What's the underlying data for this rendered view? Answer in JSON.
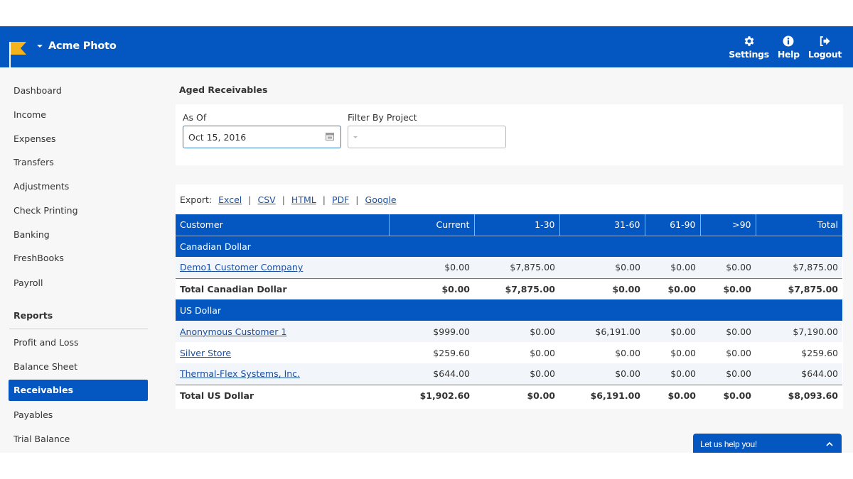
{
  "header": {
    "app_name": "Acme Photo",
    "actions": [
      {
        "label": "Settings",
        "icon": "gear-icon"
      },
      {
        "label": "Help",
        "icon": "info-icon"
      },
      {
        "label": "Logout",
        "icon": "logout-icon"
      }
    ]
  },
  "sidebar": {
    "items": [
      {
        "label": "Dashboard"
      },
      {
        "label": "Income"
      },
      {
        "label": "Expenses"
      },
      {
        "label": "Transfers"
      },
      {
        "label": "Adjustments"
      },
      {
        "label": "Check Printing"
      },
      {
        "label": "Banking"
      },
      {
        "label": "FreshBooks"
      },
      {
        "label": "Payroll"
      }
    ],
    "reports_heading": "Reports",
    "report_items": [
      {
        "label": "Profit and Loss"
      },
      {
        "label": "Balance Sheet"
      },
      {
        "label": "Receivables",
        "active": true
      },
      {
        "label": "Payables"
      },
      {
        "label": "Trial Balance"
      }
    ]
  },
  "main": {
    "title": "Aged Receivables",
    "filters": {
      "as_of_label": "As Of",
      "as_of_value": "Oct 15, 2016",
      "project_label": "Filter By Project",
      "project_value": ""
    },
    "export": {
      "label": "Export:",
      "links": [
        "Excel",
        "CSV",
        "HTML",
        "PDF",
        "Google"
      ]
    },
    "table": {
      "columns": [
        "Customer",
        "Current",
        "1-30",
        "31-60",
        "61-90",
        ">90",
        "Total"
      ],
      "groups": [
        {
          "name": "Canadian Dollar",
          "rows": [
            {
              "customer": "Demo1 Customer Company",
              "values": [
                "$0.00",
                "$7,875.00",
                "$0.00",
                "$0.00",
                "$0.00",
                "$7,875.00"
              ]
            }
          ],
          "total": {
            "label": "Total Canadian Dollar",
            "values": [
              "$0.00",
              "$7,875.00",
              "$0.00",
              "$0.00",
              "$0.00",
              "$7,875.00"
            ]
          }
        },
        {
          "name": "US Dollar",
          "rows": [
            {
              "customer": "Anonymous Customer 1",
              "values": [
                "$999.00",
                "$0.00",
                "$6,191.00",
                "$0.00",
                "$0.00",
                "$7,190.00"
              ]
            },
            {
              "customer": "Silver Store",
              "values": [
                "$259.60",
                "$0.00",
                "$0.00",
                "$0.00",
                "$0.00",
                "$259.60"
              ]
            },
            {
              "customer": "Thermal-Flex Systems, Inc.",
              "values": [
                "$644.00",
                "$0.00",
                "$0.00",
                "$0.00",
                "$0.00",
                "$644.00"
              ]
            }
          ],
          "total": {
            "label": "Total US Dollar",
            "values": [
              "$1,902.60",
              "$0.00",
              "$6,191.00",
              "$0.00",
              "$0.00",
              "$8,093.60"
            ]
          }
        }
      ]
    }
  },
  "help_widget": {
    "label": "Let us help you!"
  },
  "colors": {
    "brand_blue": "#0457c0",
    "logo_yellow": "#f5b21a",
    "link": "#1a4fa0"
  }
}
